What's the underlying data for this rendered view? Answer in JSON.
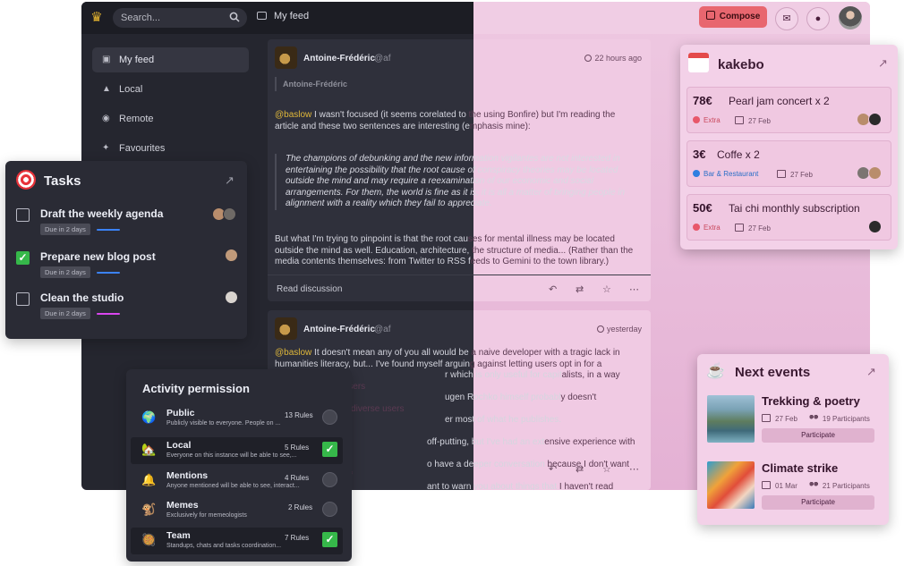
{
  "header": {
    "search_placeholder": "Search...",
    "feed_title": "My feed",
    "compose_label": "Compose",
    "mail_icon": "mail-icon",
    "bell_icon": "bell-icon"
  },
  "sidebar": {
    "items": [
      {
        "label": "My feed",
        "icon": "feed-icon"
      },
      {
        "label": "Local",
        "icon": "local-icon"
      },
      {
        "label": "Remote",
        "icon": "globe-icon"
      },
      {
        "label": "Favourites",
        "icon": "sparkle-icon"
      }
    ]
  },
  "posts": [
    {
      "author": "Antoine-Frédéric",
      "handle": "@af",
      "time": "22 hours ago",
      "reply_to": "Antoine-Frédéric",
      "mention": "@baslow",
      "text1a": " I wasn't focused (it seems corelated to ",
      "text1b": "the using Bonfire) but I'm reading the",
      "text1c": "article and these two sentences are interesting (e",
      "text1d": "mphasis mine):",
      "quote_lines": [
        [
          "The champions of debunking and the new ",
          "information vigilantes are not interested in"
        ],
        [
          "entertaining the possibility that the root caus",
          "e of conspiracy theories may be located"
        ],
        [
          "outside the mind and may require a reexaminat",
          "ion of our economic and social"
        ],
        [
          "arrangements. For them, the world is fine as i",
          "t is; it is all a matter of bringing people in"
        ],
        [
          "alignment with a reality which they fail to app",
          "reciate."
        ]
      ],
      "body_lines": [
        [
          "But what I'm trying to pinpoint is that the root cau",
          "ses for mental illness may be located"
        ],
        [
          "outside the mind as well. Education, architecture, ",
          "the structure of media... (Rather than the"
        ],
        [
          "media contents themselves: from Twitter to RSS f",
          "eeds to Gemini to the town library.)"
        ]
      ],
      "read_label": "Read discussion"
    },
    {
      "author": "Antoine-Frédéric",
      "handle": "@af",
      "time": "yesterday",
      "mention": "@baslow",
      "lines": [
        [
          "",
          " It doesn't mean any of you all would be ",
          "a naive developer with a tragic lack in"
        ],
        [
          "humanities literacy, but... I've found myself arguin",
          "g against letting users opt in for a"
        ],
        [
          "",
          "r which is only useful for capit",
          "alists, in a way that abuses their users"
        ],
        [
          "",
          "ugen Rochko himself probabl",
          "y doesn't understand why Fediverse users"
        ],
        [
          "",
          "er most of what he publishes.",
          ""
        ],
        [
          "",
          "off-putting, but I've had an ext",
          "ensive experience with capitalistic social"
        ],
        [
          "",
          "o have a deeper conversation ",
          "because I don't want to mansplain any of"
        ],
        [
          "",
          "ant to warn you about things that ",
          "I haven't read elsewhere."
        ]
      ]
    }
  ],
  "tasks": {
    "title": "Tasks",
    "items": [
      {
        "title": "Draft the weekly agenda",
        "due": "Due in 2 days",
        "done": false,
        "bar_color": "#3b82f6"
      },
      {
        "title": "Prepare new blog post",
        "due": "Due in 2 days",
        "done": true,
        "bar_color": "#3b82f6"
      },
      {
        "title": "Clean the studio",
        "due": "Due in 2 days",
        "done": false,
        "bar_color": "#d946ef"
      }
    ]
  },
  "permission": {
    "title": "Activity permission",
    "rows": [
      {
        "emoji": "🌍",
        "name": "Public",
        "desc": "Publicly visible to everyone. People on ...",
        "rules": "13 Rules",
        "selected": false
      },
      {
        "emoji": "🏡",
        "name": "Local",
        "desc": "Everyone on this instance will be able to see,...",
        "rules": "5 Rules",
        "selected": true
      },
      {
        "emoji": "🔔",
        "name": "Mentions",
        "desc": "Anyone mentioned will be able to see, interact...",
        "rules": "4 Rules",
        "selected": false
      },
      {
        "emoji": "🐒",
        "name": "Memes",
        "desc": "Exclusively for memeologists",
        "rules": "2 Rules",
        "selected": false
      },
      {
        "emoji": "🥘",
        "name": "Team",
        "desc": "Standups, chats and tasks coordination...",
        "rules": "7 Rules",
        "selected": true
      }
    ]
  },
  "kakebo": {
    "title": "kakebo",
    "items": [
      {
        "amount": "78€",
        "name": "Pearl jam concert x 2",
        "category": "Extra",
        "cat_color": "#e8576a",
        "date": "27 Feb"
      },
      {
        "amount": "3€",
        "name": "Coffe x 2",
        "category": "Bar & Restaurant",
        "cat_color": "#2f7fe0",
        "date": "27 Feb"
      },
      {
        "amount": "50€",
        "name": "Tai chi monthly subscription",
        "category": "Extra",
        "cat_color": "#e8576a",
        "date": "27 Feb"
      }
    ]
  },
  "events": {
    "title": "Next events",
    "items": [
      {
        "name": "Trekking & poetry",
        "date": "27 Feb",
        "participants": "19 Participants",
        "button": "Participate"
      },
      {
        "name": "Climate strike",
        "date": "01 Mar",
        "participants": "21 Participants",
        "button": "Participate"
      }
    ]
  },
  "colors": {
    "compose": "#e8666f",
    "dark_bg": "#25262f",
    "pink_bg": "#eec8e1",
    "check_green": "#36b84a"
  }
}
